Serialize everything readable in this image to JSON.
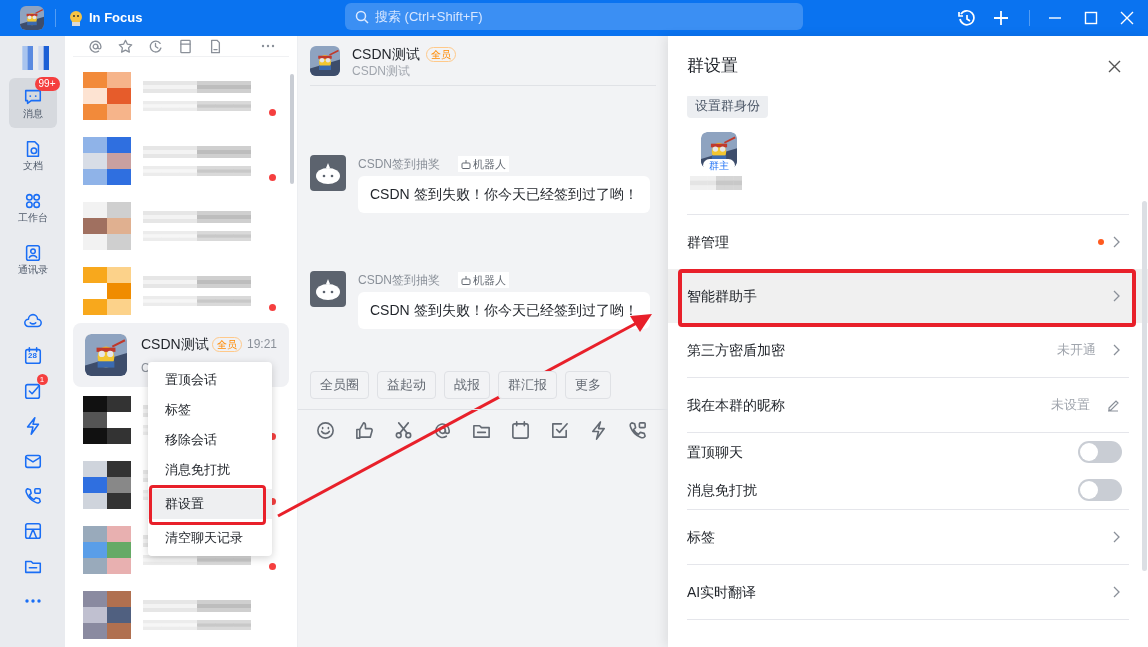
{
  "title_bar": {
    "app_name": "In Focus",
    "search_placeholder": "搜索 (Ctrl+Shift+F)"
  },
  "nav": {
    "items": [
      {
        "kind": "message",
        "label": "消息",
        "badge": "99+",
        "selected": true
      },
      {
        "kind": "doc",
        "label": "文档",
        "selected": false
      },
      {
        "kind": "workbench",
        "label": "工作台",
        "selected": false
      },
      {
        "kind": "contacts",
        "label": "通讯录",
        "selected": false
      }
    ],
    "tools": [
      {
        "kind": "cloud"
      },
      {
        "kind": "calendar",
        "text": "28"
      },
      {
        "kind": "todo",
        "badge": "1"
      },
      {
        "kind": "flash"
      },
      {
        "kind": "mail"
      },
      {
        "kind": "phone"
      },
      {
        "kind": "box"
      },
      {
        "kind": "folder"
      },
      {
        "kind": "more"
      }
    ]
  },
  "conversation_list": {
    "filters": [
      {
        "kind": "at"
      },
      {
        "kind": "star"
      },
      {
        "kind": "clock"
      },
      {
        "kind": "note"
      },
      {
        "kind": "file"
      }
    ],
    "conversations": [
      {
        "kind": "redacted",
        "unread": true
      },
      {
        "kind": "redacted",
        "unread": true
      },
      {
        "kind": "redacted",
        "unread": false
      },
      {
        "kind": "redacted",
        "unread": true
      },
      {
        "kind": "chat",
        "name": "CSDN测试",
        "badge": "全员",
        "time": "19:21",
        "preview": "C",
        "selected": true
      },
      {
        "kind": "redacted",
        "unread": true
      },
      {
        "kind": "redacted",
        "unread": true
      },
      {
        "kind": "redacted",
        "unread": true
      },
      {
        "kind": "redacted",
        "unread": false
      }
    ]
  },
  "context_menu": {
    "items": [
      {
        "label": "置顶会话",
        "selected": false
      },
      {
        "label": "标签",
        "selected": false
      },
      {
        "label": "移除会话",
        "selected": false
      },
      {
        "label": "消息免打扰",
        "selected": false
      },
      {
        "label": "群设置",
        "selected": true
      },
      {
        "label": "清空聊天记录",
        "selected": false
      }
    ]
  },
  "chat": {
    "name": "CSDN测试",
    "badge": "全员",
    "subtitle": "CSDN测试",
    "messages": [
      {
        "sender": "CSDN签到抽奖",
        "tag": "机器人",
        "text": "CSDN 签到失败！你今天已经签到过了哟！"
      },
      {
        "sender": "CSDN签到抽奖",
        "tag": "机器人",
        "text": "CSDN 签到失败！你今天已经签到过了哟！"
      }
    ],
    "quick_actions": [
      "全员圈",
      "益起动",
      "战报",
      "群汇报",
      "更多"
    ],
    "toolbar": [
      {
        "kind": "emoji"
      },
      {
        "kind": "like"
      },
      {
        "kind": "scissors"
      },
      {
        "kind": "at"
      },
      {
        "kind": "folder"
      },
      {
        "kind": "calendar"
      },
      {
        "kind": "check"
      },
      {
        "kind": "flash"
      },
      {
        "kind": "phone"
      }
    ]
  },
  "group_settings": {
    "title": "群设置",
    "identity_button": "设置群身份",
    "owner_badge": "群主",
    "rows": [
      {
        "kind": "link",
        "label": "群管理",
        "dot": true,
        "selected": false
      },
      {
        "kind": "link",
        "label": "智能群助手",
        "dot": false,
        "selected": true
      },
      {
        "kind": "link",
        "label": "第三方密盾加密",
        "value": "未开通",
        "dot": false,
        "selected": false
      },
      {
        "kind": "edit",
        "label": "我在本群的昵称",
        "value": "未设置"
      },
      {
        "kind": "toggle",
        "label": "置顶聊天",
        "on": false
      },
      {
        "kind": "toggle",
        "label": "消息免打扰",
        "on": false
      },
      {
        "kind": "link",
        "label": "标签",
        "dot": false,
        "selected": false
      },
      {
        "kind": "link",
        "label": "AI实时翻译",
        "dot": false,
        "selected": false
      }
    ]
  }
}
